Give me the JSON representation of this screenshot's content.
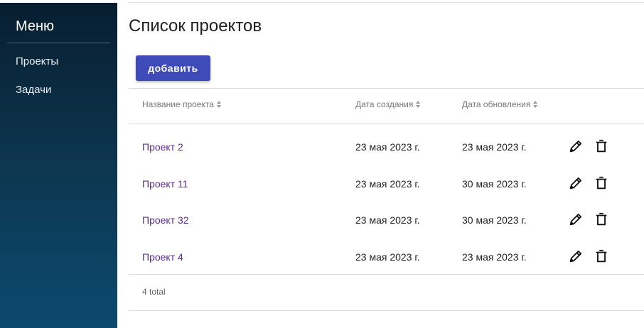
{
  "sidebar": {
    "title": "Меню",
    "items": [
      {
        "label": "Проекты"
      },
      {
        "label": "Задачи"
      }
    ]
  },
  "main": {
    "title": "Список проектов",
    "add_button_label": "добавить",
    "table": {
      "columns": [
        {
          "label": "Название проекта"
        },
        {
          "label": "Дата создания"
        },
        {
          "label": "Дата обновления"
        }
      ],
      "rows": [
        {
          "name": "Проект 2",
          "created": "23 мая 2023 г.",
          "updated": "23 мая 2023 г."
        },
        {
          "name": "Проект 11",
          "created": "23 мая 2023 г.",
          "updated": "30 мая 2023 г."
        },
        {
          "name": "Проект 32",
          "created": "23 мая 2023 г.",
          "updated": "30 мая 2023 г."
        },
        {
          "name": "Проект 4",
          "created": "23 мая 2023 г.",
          "updated": "23 мая 2023 г."
        }
      ],
      "row_actions": [
        "pencil-icon",
        "trash-icon"
      ],
      "total": "4 total"
    }
  },
  "colors": {
    "sidebar_top": "#081e30",
    "sidebar_bottom": "#0b4a6e",
    "accent_button": "#3f4bb8",
    "project_link": "#5b2b8f"
  }
}
